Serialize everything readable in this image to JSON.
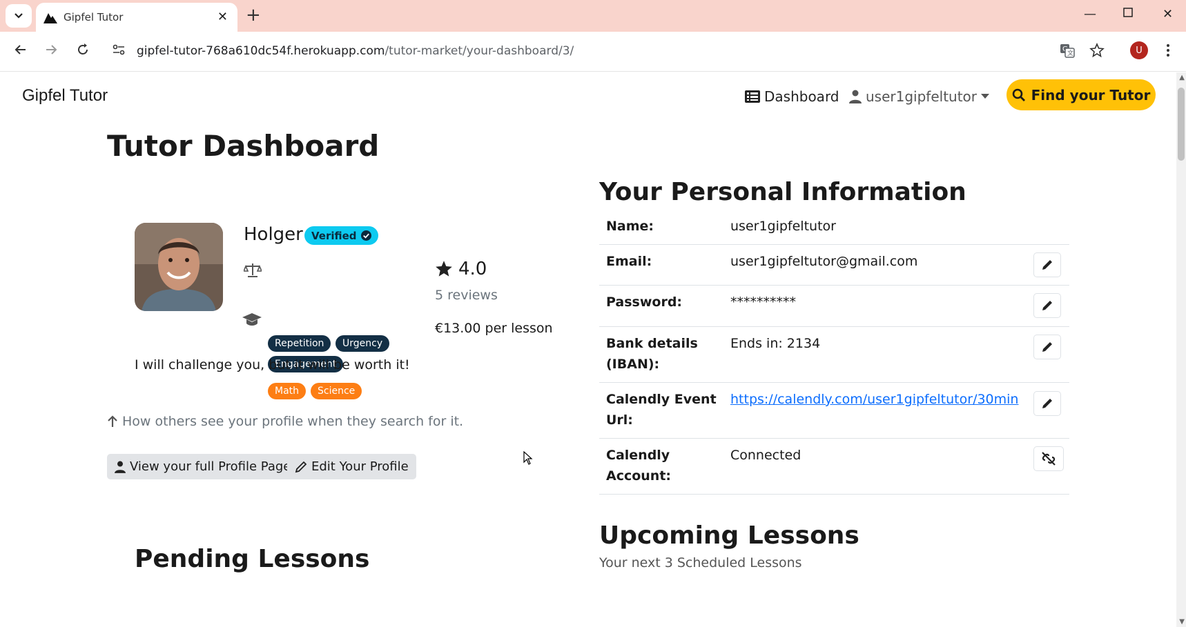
{
  "browser": {
    "tab_title": "Gipfel Tutor",
    "url_host": "gipfel-tutor-768a610dc54f.herokuapp.com",
    "url_path": "/tutor-market/your-dashboard/3/",
    "profile_initial": "U"
  },
  "navbar": {
    "brand": "Gipfel Tutor",
    "dashboard_label": "Dashboard",
    "user_label": "user1gipfeltutor",
    "find_button_label": "Find your Tutor"
  },
  "page": {
    "title": "Tutor Dashboard"
  },
  "profile_card": {
    "name": "Holger",
    "verified_label": "Verified",
    "teaching_styles": [
      "Repetition",
      "Urgency",
      "Engagement"
    ],
    "subjects": [
      "Math",
      "Science"
    ],
    "rating": "4.0",
    "reviews": "5 reviews",
    "price": "€13.00 per lesson",
    "bio": "I will challenge you, but it will be worth it!",
    "hint": "How others see your profile when they search for it.",
    "view_profile_button": "View your full Profile Page",
    "edit_profile_button": "Edit Your Profile"
  },
  "personal_info": {
    "title": "Your Personal Information",
    "rows": [
      {
        "label": "Name:",
        "value": "user1gipfeltutor"
      },
      {
        "label": "Email:",
        "value": "user1gipfeltutor@gmail.com"
      },
      {
        "label": "Password:",
        "value": "**********"
      },
      {
        "label_line1": "Bank details",
        "label_line2": "(IBAN):",
        "value": "Ends in: 2134"
      },
      {
        "label_line1": "Calendly Event",
        "label_line2": "Url:",
        "value": "https://calendly.com/user1gipfeltutor/30min"
      },
      {
        "label_line1": "Calendly",
        "label_line2": "Account:",
        "value": "Connected"
      }
    ]
  },
  "upcoming": {
    "title": "Upcoming Lessons",
    "subtitle": "Your next 3 Scheduled Lessons"
  },
  "pending": {
    "title": "Pending Lessons"
  },
  "colors": {
    "accent_yellow": "#ffc107",
    "badge_dark": "#132f45",
    "badge_orange": "#fd7e14",
    "verified_cyan": "#0dcaf0",
    "link_blue": "#0d6efd"
  }
}
